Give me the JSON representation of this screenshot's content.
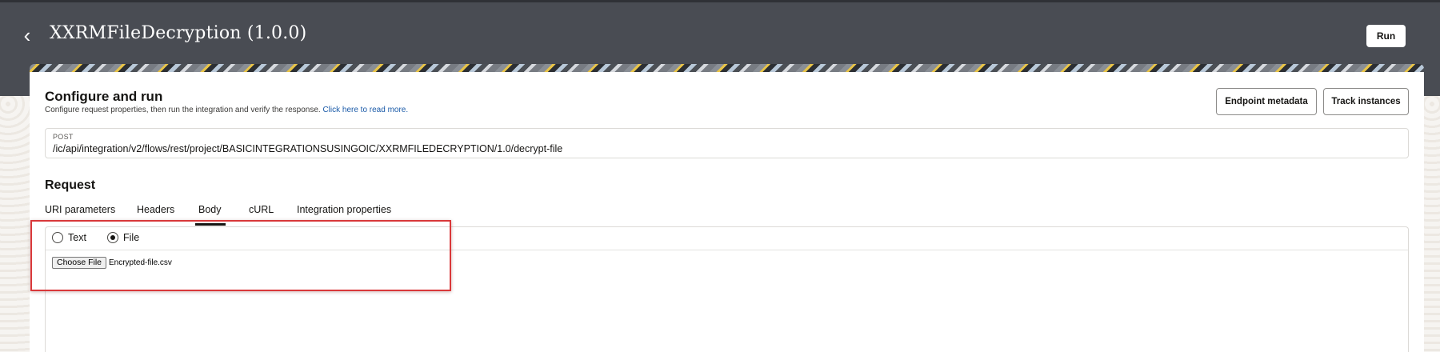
{
  "header": {
    "back_icon": "chevron-left-icon",
    "title": "XXRMFileDecryption (1.0.0)",
    "run_label": "Run"
  },
  "configure": {
    "title": "Configure and run",
    "description": "Configure request properties, then run the integration and verify the response.",
    "read_more": "Click here to read more.",
    "endpoint_metadata_label": "Endpoint metadata",
    "track_instances_label": "Track instances"
  },
  "endpoint": {
    "method": "POST",
    "url": "/ic/api/integration/v2/flows/rest/project/BASICINTEGRATIONSUSINGOIC/XXRMFILEDECRYPTION/1.0/decrypt-file"
  },
  "request": {
    "title": "Request",
    "tabs": [
      {
        "label": "URI parameters"
      },
      {
        "label": "Headers"
      },
      {
        "label": "Body"
      },
      {
        "label": "cURL"
      },
      {
        "label": "Integration properties"
      }
    ],
    "active_tab": "Body"
  },
  "body": {
    "options": [
      {
        "label": "Text",
        "selected": false
      },
      {
        "label": "File",
        "selected": true
      }
    ],
    "choose_file_label": "Choose File",
    "file_name": "Encrypted-file.csv"
  },
  "colors": {
    "header_bg": "#494c53",
    "highlight": "#d9383a",
    "link": "#1a5aa8"
  }
}
